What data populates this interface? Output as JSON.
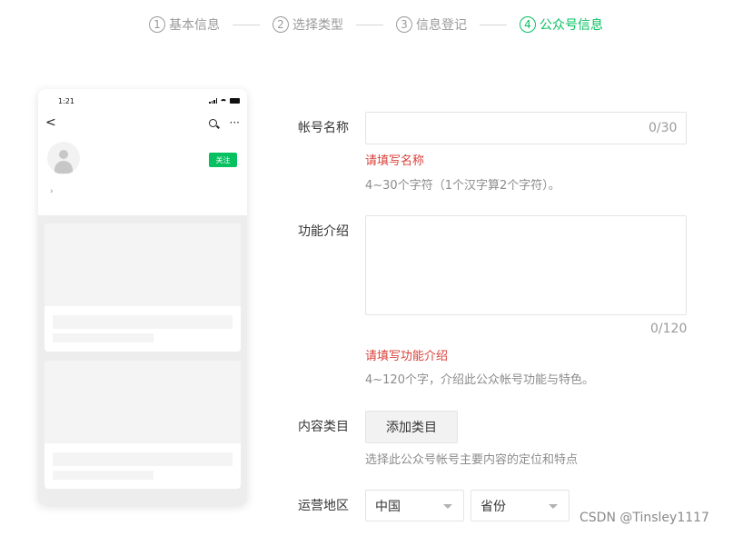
{
  "steps": [
    {
      "num": "1",
      "label": "基本信息",
      "active": false
    },
    {
      "num": "2",
      "label": "选择类型",
      "active": false
    },
    {
      "num": "3",
      "label": "信息登记",
      "active": false
    },
    {
      "num": "4",
      "label": "公众号信息",
      "active": true
    }
  ],
  "accent_color": "#07c160",
  "error_color": "#d9403a",
  "preview": {
    "time": "1:21",
    "follow_label": "关注",
    "back_icon": "chevron-left-icon",
    "search_icon": "search-icon",
    "more_icon": "more-icon",
    "more_glyph": "···",
    "back_glyph": "<",
    "chevron_glyph": "›"
  },
  "form": {
    "name": {
      "label": "帐号名称",
      "value": "",
      "counter": "0/30",
      "error": "请填写名称",
      "hint": "4~30个字符（1个汉字算2个字符）。"
    },
    "intro": {
      "label": "功能介绍",
      "value": "",
      "counter": "0/120",
      "error": "请填写功能介绍",
      "hint": "4~120个字，介绍此公众帐号功能与特色。"
    },
    "category": {
      "label": "内容类目",
      "button": "添加类目",
      "hint": "选择此公众号帐号主要内容的定位和特点"
    },
    "region": {
      "label": "运营地区",
      "country": "中国",
      "province": "省份"
    }
  },
  "watermark": "CSDN @Tinsley1117"
}
